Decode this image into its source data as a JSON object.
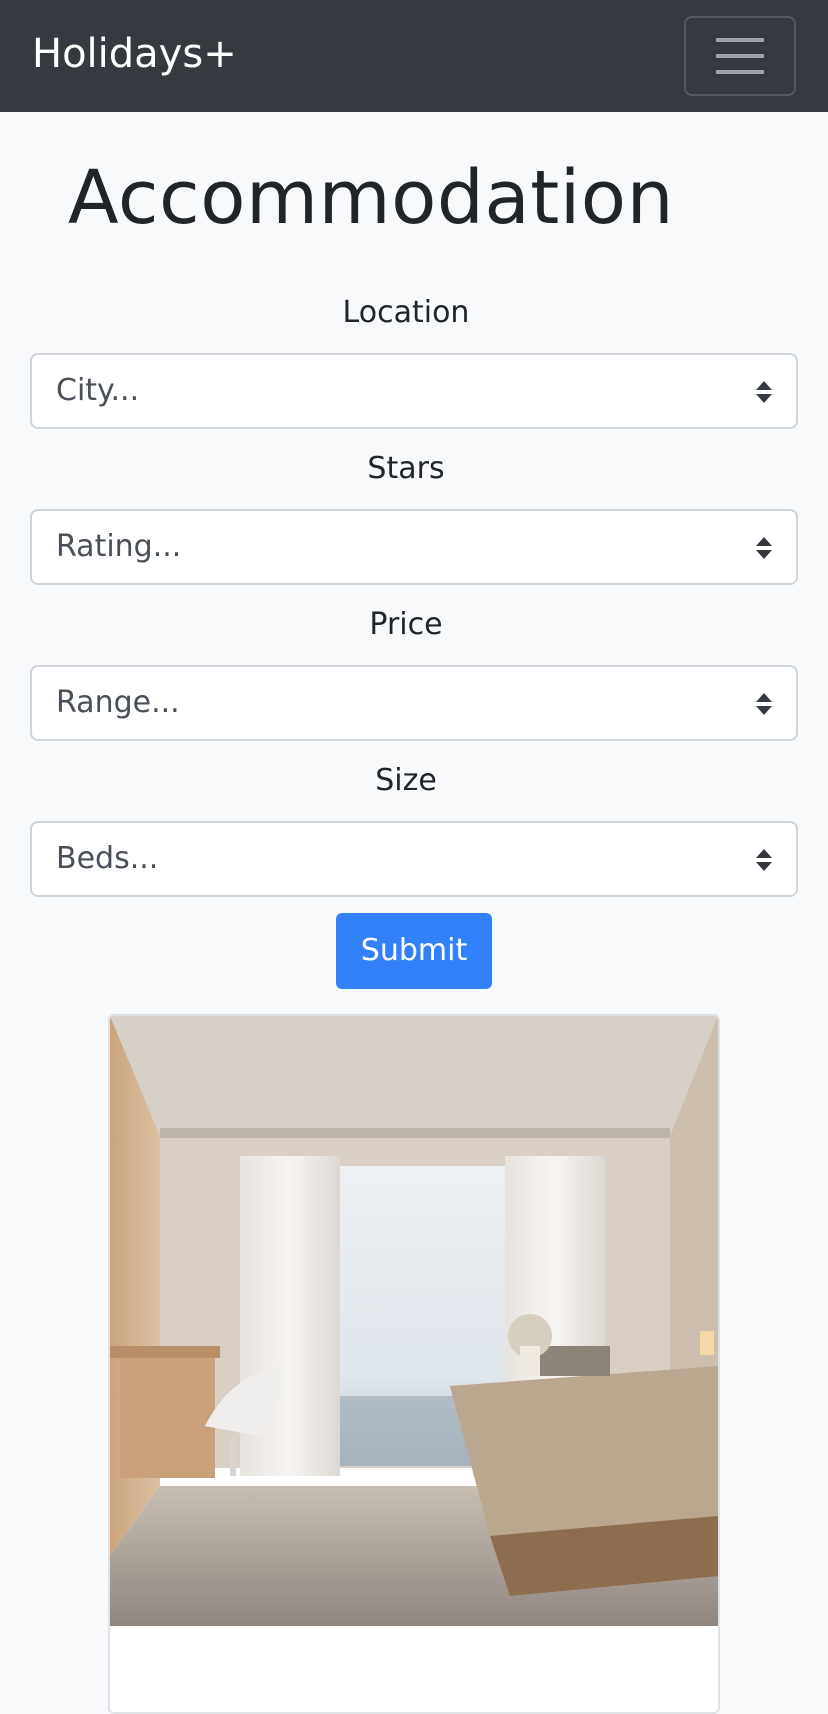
{
  "navbar": {
    "brand": "Holidays+",
    "toggler_icon": "hamburger-menu-icon"
  },
  "page": {
    "title": "Accommodation"
  },
  "form": {
    "fields": [
      {
        "label": "Location",
        "value": "City..."
      },
      {
        "label": "Stars",
        "value": "Rating..."
      },
      {
        "label": "Price",
        "value": "Range..."
      },
      {
        "label": "Size",
        "value": "Beds..."
      }
    ],
    "submit_label": "Submit"
  },
  "listing": {
    "image_description": "hotel-bedroom-photo"
  },
  "colors": {
    "navbar": "#343a40",
    "primary": "#3381fa",
    "background": "#f8f9fa"
  }
}
